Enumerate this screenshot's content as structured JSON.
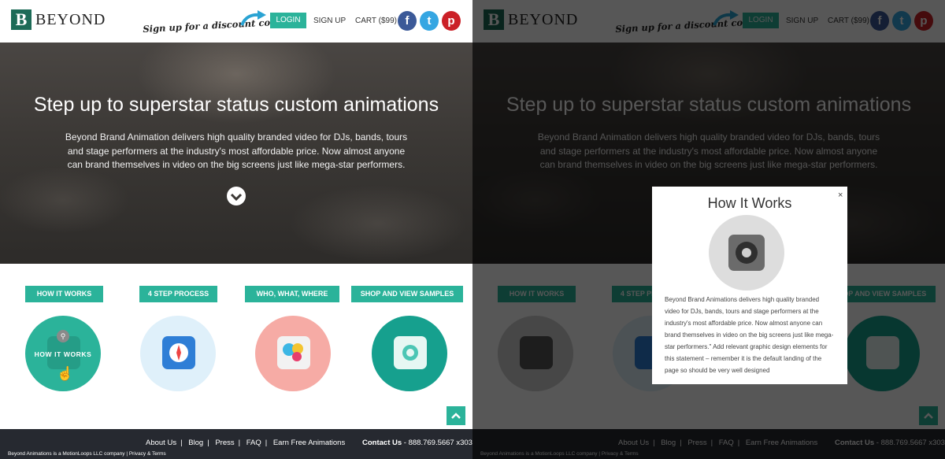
{
  "header": {
    "logo_letter": "B",
    "logo_text": "BEYOND",
    "promo": "Sign up for a discount code!",
    "login": "LOGIN",
    "signup": "SIGN UP",
    "cart": "CART ($99)",
    "social": {
      "facebook": "f",
      "twitter": "t",
      "pinterest": "p"
    }
  },
  "hero": {
    "title": "Step up to superstar status custom animations",
    "body": "Beyond Brand Animation delivers high quality branded video for DJs, bands, tours and stage performers at the industry's most affordable price. Now almost anyone can brand themselves in video on the big screens just like mega-star performers."
  },
  "features": {
    "buttons": [
      "HOW IT WORKS",
      "4 STEP PROCESS",
      "WHO, WHAT, WHERE",
      "SHOP AND VIEW SAMPLES"
    ],
    "hover_label": "HOW IT WORKS"
  },
  "footer": {
    "links": [
      "About Us",
      "Blog",
      "Press",
      "FAQ",
      "Earn Free Animations"
    ],
    "contact_label": "Contact Us",
    "contact_phone": " - 888.769.5667 x303",
    "copyright": "Beyond Animations is a MotionLoops LLC company",
    "privacy": "Privacy & Terms"
  },
  "modal": {
    "title": "How It Works",
    "close": "×",
    "body": "Beyond Brand Animations delivers high quality branded video for DJs, bands, tours and stage performers at the industry's most affordable price. Now almost anyone can brand themselves in video on the big screens just like mega-star performers.\" Add relevant graphic design elements for this statement – remember it is the default landing of the page so should be very well designed"
  },
  "colors": {
    "accent": "#2bb39a",
    "footer": "#262930",
    "circle_teal": "#2bb39a",
    "circle_lightblue": "#dff0fa",
    "circle_pink": "#f6aba5",
    "circle_darkteal": "#16a08e"
  }
}
